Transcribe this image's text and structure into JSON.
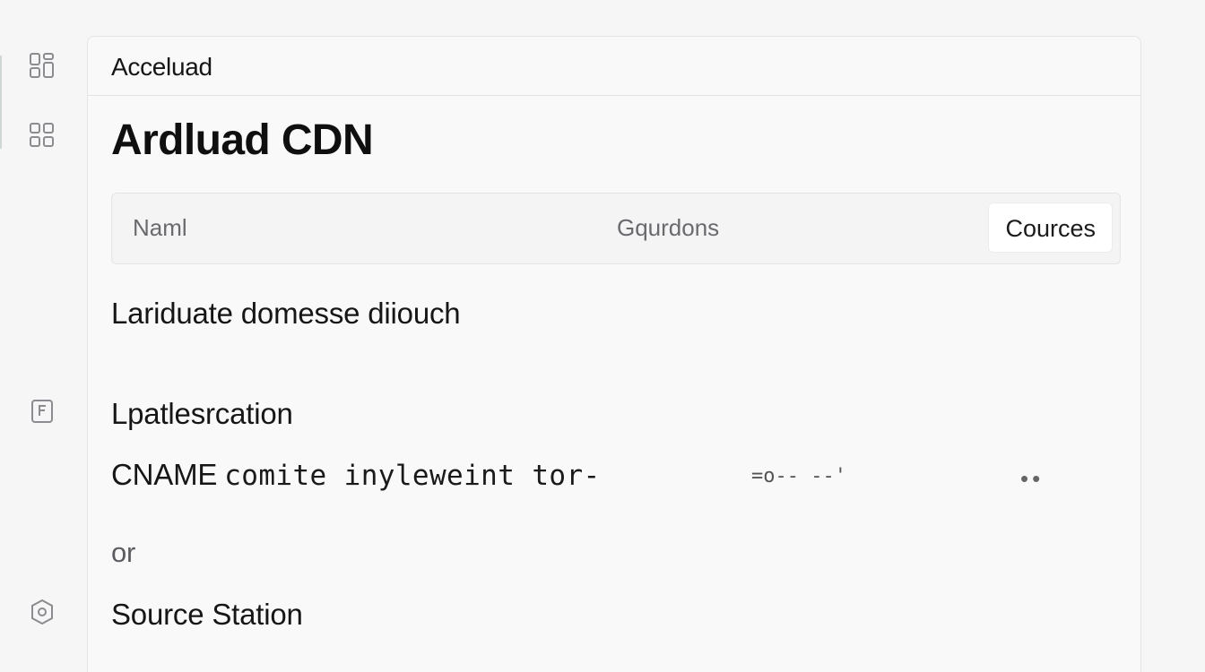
{
  "rail": {
    "icons": [
      {
        "name": "grid-icon"
      },
      {
        "name": "grid-icon"
      },
      {
        "name": "document-icon"
      },
      {
        "name": "settings-icon"
      }
    ],
    "accent_color": "#cfd6d6"
  },
  "panel": {
    "breadcrumb": "Acceluad",
    "title": "Ardluad CDN",
    "table": {
      "columns": [
        "Naml",
        "Gqurdons"
      ],
      "sources_button": "Cources"
    },
    "description": "Laridu​ate domesse diiouch",
    "update_label": "Lpatlesrcation",
    "cname": {
      "label": "CNAME",
      "value": "comite inyleweint tor-",
      "tail": "=o-- --'",
      "menu": "••"
    },
    "or_label": "or",
    "source_label": "Source Station"
  },
  "colors": {
    "background": "#f6f6f7",
    "panel": "#f9f9fa",
    "border": "#e4e4e7",
    "text": "#141414",
    "muted": "#6a6a6e"
  }
}
